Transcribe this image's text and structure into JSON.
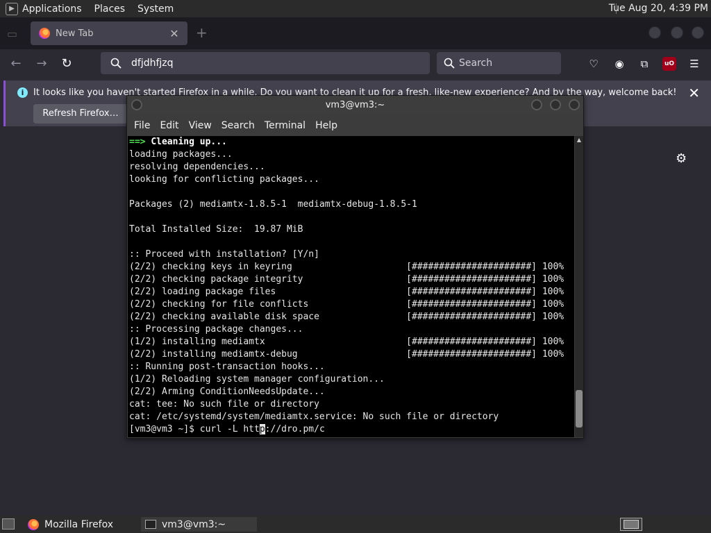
{
  "top_panel": {
    "menus": [
      "Applications",
      "Places",
      "System"
    ],
    "clock": "Tue Aug 20,  4:39 PM"
  },
  "firefox": {
    "tab": {
      "title": "New Tab",
      "close_icon": "close-icon"
    },
    "url_value": "dfjdhfjzq",
    "search_placeholder": "Search",
    "notification": {
      "message": "It looks like you haven't started Firefox in a while. Do you want to clean it up for a fresh, like-new experience? And by the way, welcome back!",
      "button": "Refresh Firefox…"
    }
  },
  "terminal": {
    "title": "vm3@vm3:~",
    "menu": [
      "File",
      "Edit",
      "View",
      "Search",
      "Terminal",
      "Help"
    ],
    "cleanup_arrow": "==>",
    "cleanup_text": "Cleaning up...",
    "lines": [
      "loading packages...",
      "resolving dependencies...",
      "looking for conflicting packages...",
      "",
      "Packages (2) mediamtx-1.8.5-1  mediamtx-debug-1.8.5-1",
      "",
      "Total Installed Size:  19.87 MiB",
      "",
      ":: Proceed with installation? [Y/n]",
      "(2/2) checking keys in keyring                     [######################] 100%",
      "(2/2) checking package integrity                   [######################] 100%",
      "(2/2) loading package files                        [######################] 100%",
      "(2/2) checking for file conflicts                  [######################] 100%",
      "(2/2) checking available disk space                [######################] 100%",
      ":: Processing package changes...",
      "(1/2) installing mediamtx                          [######################] 100%",
      "(2/2) installing mediamtx-debug                    [######################] 100%",
      ":: Running post-transaction hooks...",
      "(1/2) Reloading system manager configuration...",
      "(2/2) Arming ConditionNeedsUpdate...",
      "cat: tee: No such file or directory",
      "cat: /etc/systemd/system/mediamtx.service: No such file or directory"
    ],
    "prompt_before_cursor": "[vm3@vm3 ~]$ curl -L htt",
    "cursor_char": "p",
    "prompt_after_cursor": "://dro.pm/c"
  },
  "taskbar": {
    "tasks": [
      "Mozilla Firefox",
      "vm3@vm3:~"
    ]
  }
}
